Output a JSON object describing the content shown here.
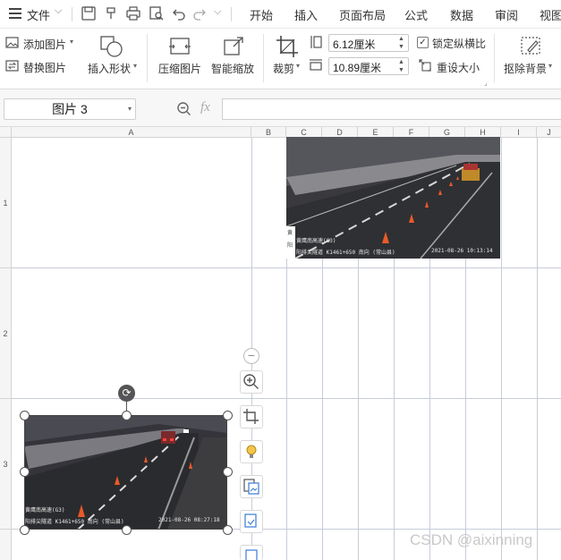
{
  "menubar": {
    "file_label": "文件",
    "tabs": [
      "开始",
      "插入",
      "页面布局",
      "公式",
      "数据",
      "审阅",
      "视图"
    ]
  },
  "ribbon": {
    "add_picture": "添加图片",
    "replace_picture": "替换图片",
    "insert_shape": "插入形状",
    "compress_picture": "压缩图片",
    "smart_zoom": "智能缩放",
    "crop": "裁剪",
    "height_value": "6.12厘米",
    "width_value": "10.89厘米",
    "lock_aspect": "锁定纵横比",
    "reset_size": "重设大小",
    "remove_background": "抠除背景",
    "lock_aspect_checked": true
  },
  "formula_bar": {
    "name_box": "图片 3",
    "fx_label": "fx"
  },
  "sheet": {
    "columns": [
      "A",
      "B",
      "C",
      "D",
      "E",
      "F",
      "G",
      "H",
      "I",
      "J"
    ],
    "rows": [
      "1",
      "2",
      "3"
    ]
  },
  "image_top": {
    "caption_line1": "黄鹰南高速(G3)",
    "caption_line2": "阳排尖隧道 K1461+650 南向 (常山县)",
    "timestamp": "2021-08-26 10:13:14",
    "side_text_1": "黄",
    "side_text_2": "阳"
  },
  "image_bottom": {
    "caption_line1": "黄鹰南高速(G3)",
    "caption_line2": "阳排尖隧道 K1461+650 南向 (常山县)",
    "timestamp": "2021-08-26 08:27:18"
  },
  "watermark": "CSDN @aixinning",
  "colors": {
    "grid_line": "#c7ccd9",
    "accent": "#333333"
  }
}
